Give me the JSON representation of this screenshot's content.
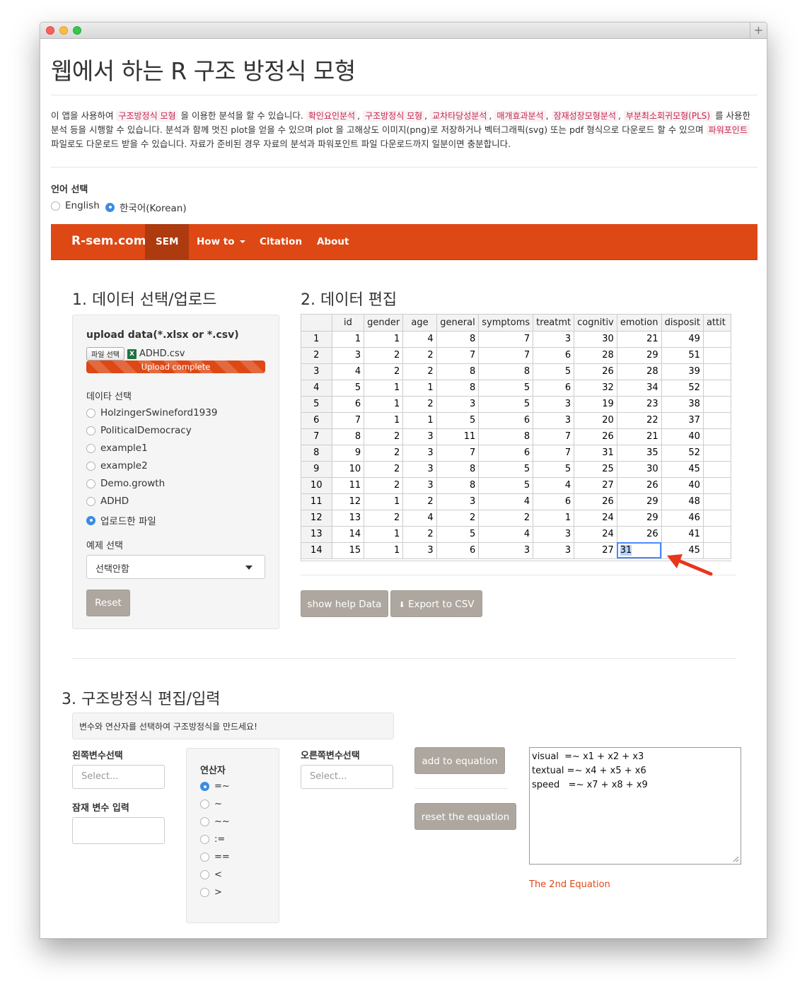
{
  "page": {
    "title": "웹에서 하는 R 구조 방정식 모형",
    "intro": {
      "p1": "이 앱을 사용하여",
      "hl1": "구조방정식 모형",
      "p2": "을 이용한 분석을 할 수 있습니다.",
      "hl2": "확인요인분석",
      "hl3": "구조방정식 모형",
      "hl4": "교차타당성분석",
      "hl5": "매개효과분석",
      "hl6": "잠재성장모형분석",
      "hl7": "부분최소회귀모형(PLS)",
      "p3": "를 사용한 분석 등을 시행할 수 있습니다. 분석과 함께 멋진 plot을 얻을 수 있으며 plot 을 고해상도 이미지(png)로 저장하거나 벡터그래픽(svg) 또는 pdf 형식으로 다운로드 할 수 있으며",
      "hl8": "파워포인트",
      "p4": "파일로도 다운로드 받을 수 있습니다. 자료가 준비된 경우 자료의 분석과 파워포인트 파일 다운로드까지 일분이면 충분합니다."
    },
    "language": {
      "label": "언어 선택",
      "options": [
        "English",
        "한국어(Korean)"
      ],
      "selected": "한국어(Korean)"
    }
  },
  "navbar": {
    "brand": "R-sem.com",
    "items": [
      "SEM",
      "How to",
      "Citation",
      "About"
    ],
    "active": "SEM"
  },
  "section1": {
    "heading": "1. 데이터 선택/업로드",
    "upload_label": "upload data(*.xlsx or *.csv)",
    "file_button": "파일 선택",
    "file_name": "ADHD.csv",
    "progress_text": "Upload complete",
    "progress_value": 1.0,
    "data_select_label": "데이타 선택",
    "datasets": [
      "HolzingerSwineford1939",
      "PoliticalDemocracy",
      "example1",
      "example2",
      "Demo.growth",
      "ADHD",
      "업로드한 파일"
    ],
    "selected_dataset": "업로드한 파일",
    "example_label": "예제 선택",
    "example_value": "선택안함",
    "reset_button": "Reset"
  },
  "section2": {
    "heading": "2. 데이터 편집",
    "columns": [
      "id",
      "gender",
      "age",
      "general",
      "symptoms",
      "treatmt",
      "cognitiv",
      "emotion",
      "disposit",
      "attit"
    ],
    "rows": [
      [
        "1",
        "1",
        "1",
        "4",
        "8",
        "7",
        "3",
        "30",
        "21",
        "49",
        ""
      ],
      [
        "2",
        "3",
        "2",
        "2",
        "7",
        "7",
        "6",
        "28",
        "29",
        "51",
        ""
      ],
      [
        "3",
        "4",
        "2",
        "2",
        "8",
        "8",
        "5",
        "26",
        "28",
        "39",
        ""
      ],
      [
        "4",
        "5",
        "1",
        "1",
        "8",
        "5",
        "6",
        "32",
        "34",
        "52",
        ""
      ],
      [
        "5",
        "6",
        "1",
        "2",
        "3",
        "5",
        "3",
        "19",
        "23",
        "38",
        ""
      ],
      [
        "6",
        "7",
        "1",
        "1",
        "5",
        "6",
        "3",
        "20",
        "22",
        "37",
        ""
      ],
      [
        "7",
        "8",
        "2",
        "3",
        "11",
        "8",
        "7",
        "26",
        "21",
        "40",
        ""
      ],
      [
        "8",
        "9",
        "2",
        "3",
        "7",
        "6",
        "7",
        "31",
        "35",
        "52",
        ""
      ],
      [
        "9",
        "10",
        "2",
        "3",
        "8",
        "5",
        "5",
        "25",
        "30",
        "45",
        ""
      ],
      [
        "10",
        "11",
        "2",
        "3",
        "8",
        "5",
        "4",
        "27",
        "26",
        "40",
        ""
      ],
      [
        "11",
        "12",
        "1",
        "2",
        "3",
        "4",
        "6",
        "26",
        "29",
        "48",
        ""
      ],
      [
        "12",
        "13",
        "2",
        "4",
        "2",
        "2",
        "1",
        "24",
        "29",
        "46",
        ""
      ],
      [
        "13",
        "14",
        "1",
        "2",
        "5",
        "4",
        "3",
        "24",
        "26",
        "41",
        ""
      ],
      [
        "14",
        "15",
        "1",
        "3",
        "6",
        "3",
        "3",
        "27",
        "31",
        "45",
        ""
      ]
    ],
    "selected_cell_value": "31",
    "show_help_button": "show help Data",
    "export_button": "Export to CSV"
  },
  "section3": {
    "heading": "3. 구조방정식 편집/입력",
    "notice": "변수와 연산자를 선택하여 구조방정식을 만드세요!",
    "left_var_label": "왼쪽변수선택",
    "left_var_placeholder": "Select...",
    "latent_label": "잠재 변수 입력",
    "operator_label": "연산자",
    "operators": [
      "=~",
      "~",
      "~~",
      ":=",
      "==",
      "<",
      ">"
    ],
    "selected_operator": "=~",
    "right_var_label": "오른쪽변수선택",
    "right_var_placeholder": "Select...",
    "add_button": "add to equation",
    "reset_button": "reset the equation",
    "equation_lines": [
      "visual  =~ x1 + x2 + x3",
      "textual =~ x4 + x5 + x6",
      "speed   =~ x7 + x8 + x9"
    ],
    "second_equation_link": "The 2nd Equation"
  },
  "colors": {
    "navbar": "#dd4814",
    "nav_active": "#ae3a10",
    "gray_button": "#aea79f",
    "highlight_text": "#c7254e",
    "radio_on": "#3b8be6",
    "arrow": "#e8351c"
  }
}
